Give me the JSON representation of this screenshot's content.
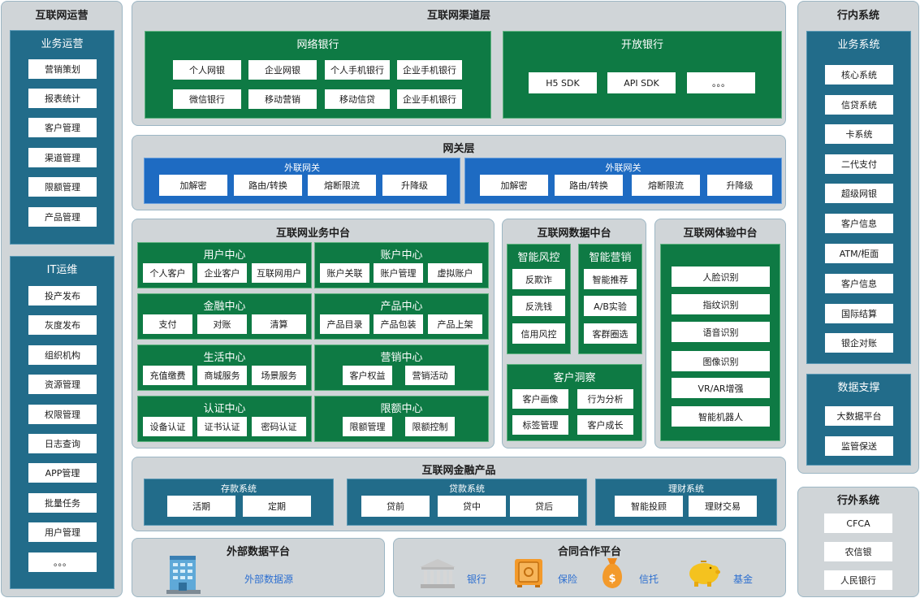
{
  "left": {
    "title": "互联网运营",
    "ops": {
      "title": "业务运营",
      "items": [
        "营销策划",
        "报表统计",
        "客户管理",
        "渠道管理",
        "限额管理",
        "产品管理"
      ]
    },
    "it": {
      "title": "IT运维",
      "items": [
        "投产发布",
        "灰度发布",
        "组织机构",
        "资源管理",
        "权限管理",
        "日志查询",
        "APP管理",
        "批量任务",
        "用户管理",
        "。。。"
      ]
    }
  },
  "channel": {
    "title": "互联网渠道层",
    "netbank": {
      "title": "网络银行",
      "items": [
        "个人网银",
        "企业网银",
        "个人手机银行",
        "企业手机银行",
        "微信银行",
        "移动营销",
        "移动信贷",
        "企业手机银行"
      ]
    },
    "openbank": {
      "title": "开放银行",
      "items": [
        "H5 SDK",
        "API SDK",
        "。。。"
      ]
    }
  },
  "gateway": {
    "title": "网关层",
    "groups": [
      {
        "title": "外联网关",
        "items": [
          "加解密",
          "路由/转换",
          "熔断限流",
          "升降级"
        ]
      },
      {
        "title": "外联网关",
        "items": [
          "加解密",
          "路由/转换",
          "熔断限流",
          "升降级"
        ]
      }
    ]
  },
  "biz": {
    "title": "互联网业务中台",
    "centers": [
      {
        "title": "用户中心",
        "items": [
          "个人客户",
          "企业客户",
          "互联网用户"
        ]
      },
      {
        "title": "账户中心",
        "items": [
          "账户关联",
          "账户管理",
          "虚拟账户"
        ]
      },
      {
        "title": "金融中心",
        "items": [
          "支付",
          "对账",
          "清算"
        ]
      },
      {
        "title": "产品中心",
        "items": [
          "产品目录",
          "产品包装",
          "产品上架"
        ]
      },
      {
        "title": "生活中心",
        "items": [
          "充值缴费",
          "商城服务",
          "场景服务"
        ]
      },
      {
        "title": "营销中心",
        "items": [
          "客户权益",
          "营销活动"
        ]
      },
      {
        "title": "认证中心",
        "items": [
          "设备认证",
          "证书认证",
          "密码认证"
        ]
      },
      {
        "title": "限额中心",
        "items": [
          "限额管理",
          "限额控制"
        ]
      }
    ]
  },
  "data": {
    "title": "互联网数据中台",
    "risk": {
      "title": "智能风控",
      "items": [
        "反欺诈",
        "反洗钱",
        "信用风控"
      ]
    },
    "mkt": {
      "title": "智能营销",
      "items": [
        "智能推荐",
        "A/B实验",
        "客群圈选"
      ]
    },
    "insight": {
      "title": "客户洞察",
      "items": [
        "客户画像",
        "行为分析",
        "标签管理",
        "客户成长"
      ]
    }
  },
  "exp": {
    "title": "互联网体验中台",
    "items": [
      "人脸识别",
      "指纹识别",
      "语音识别",
      "图像识别",
      "VR/AR增强",
      "智能机器人"
    ]
  },
  "fin": {
    "title": "互联网金融产品",
    "groups": [
      {
        "title": "存款系统",
        "items": [
          "活期",
          "定期"
        ]
      },
      {
        "title": "贷款系统",
        "items": [
          "贷前",
          "贷中",
          "贷后"
        ]
      },
      {
        "title": "理财系统",
        "items": [
          "智能投顾",
          "理财交易"
        ]
      }
    ]
  },
  "extdata": {
    "title": "外部数据平台",
    "label": "外部数据源"
  },
  "coop": {
    "title": "合同合作平台",
    "items": [
      "银行",
      "保险",
      "信托",
      "基金"
    ]
  },
  "inner": {
    "title": "行内系统",
    "biz": {
      "title": "业务系统",
      "items": [
        "核心系统",
        "信贷系统",
        "卡系统",
        "二代支付",
        "超级网银",
        "客户信息",
        "ATM/柜面",
        "客户信息",
        "国际结算",
        "银企对账"
      ]
    },
    "support": {
      "title": "数据支撑",
      "items": [
        "大数据平台",
        "监管保送"
      ]
    }
  },
  "outer": {
    "title": "行外系统",
    "items": [
      "CFCA",
      "农信银",
      "人民银行"
    ]
  },
  "colors": {
    "green": "#0e7a44",
    "blue": "#1e6bc2",
    "teal": "#226c8a",
    "panel": "#d0d5d8"
  }
}
